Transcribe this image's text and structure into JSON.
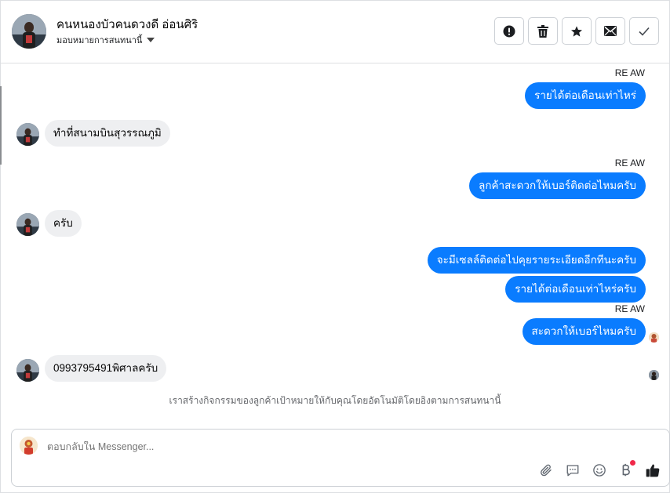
{
  "header": {
    "contact_name": "คนหนองบัวคนดวงดี อ่อนศิริ",
    "assign_label": "มอบหมายการสนทนานี้",
    "actions": [
      {
        "name": "mark-spam-button",
        "icon": "alert-circle-icon"
      },
      {
        "name": "delete-button",
        "icon": "trash-icon"
      },
      {
        "name": "star-button",
        "icon": "star-icon"
      },
      {
        "name": "mark-unread-button",
        "icon": "envelope-icon"
      },
      {
        "name": "mark-done-button",
        "icon": "check-icon"
      }
    ]
  },
  "messages": [
    {
      "sender_label": "RE AW",
      "text": "รายได้ต่อเดือนเท่าไหร่",
      "dir": "out"
    },
    {
      "text": "ทำที่สนามบินสุวรรณภูมิ",
      "dir": "in"
    },
    {
      "sender_label": "RE AW",
      "text": "ลูกค้าสะดวกให้เบอร์ติดต่อไหมครับ",
      "dir": "out"
    },
    {
      "text": "ครับ",
      "dir": "in"
    },
    {
      "text": "จะมีเซลล์ติดต่อไปคุยรายระเอียดอีกทีนะครับ",
      "dir": "out"
    },
    {
      "text": "รายได้ต่อเดือนเท่าไหร่ครับ",
      "dir": "out"
    },
    {
      "sender_label": "RE AW",
      "text": "สะดวกให้เบอร์ไหมครับ",
      "dir": "out"
    },
    {
      "text": "0993795491พิศาลครับ",
      "dir": "in"
    }
  ],
  "system_note": "เราสร้างกิจกรรมของลูกค้าเป้าหมายให้กับคุณโดยอัตโนมัติโดยอิงตามการสนทนานี้",
  "composer": {
    "placeholder": "ตอบกลับใน Messenger...",
    "tools": [
      "paperclip-icon",
      "saved-reply-icon",
      "emoji-icon",
      "baht-payment-icon",
      "like-icon"
    ]
  },
  "colors": {
    "accent": "#0a7cff",
    "incoming_bubble": "#eeeff1",
    "notification_dot": "#f02849"
  }
}
